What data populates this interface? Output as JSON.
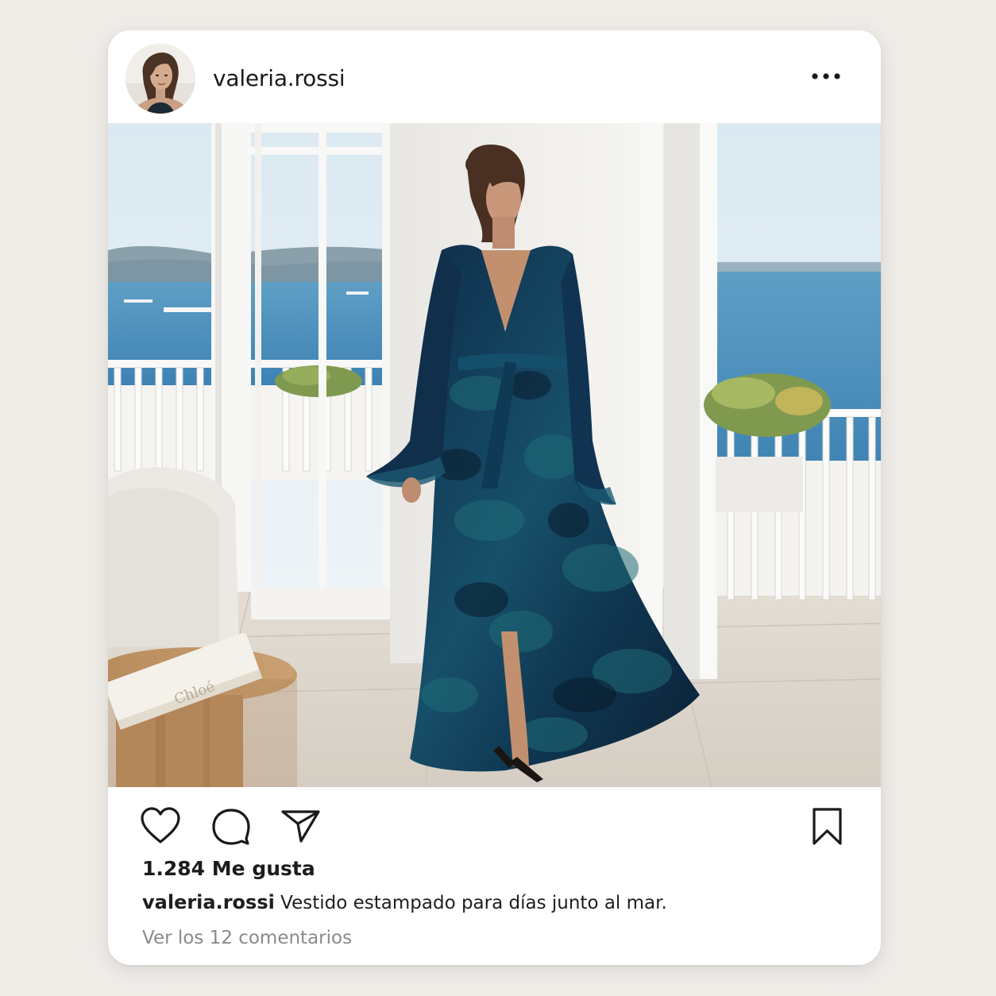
{
  "post": {
    "username": "valeria.rossi",
    "more_icon": "more-horizontal-icon",
    "photo_subject": "woman-in-floral-maxi-dress",
    "book_cover_text": "Chloé",
    "likes_text": "1.284 Me gusta",
    "caption_user": "valeria.rossi",
    "caption_text": "Vestido estampado para días junto al mar.",
    "comments_link": "Ver los 12 comentarios"
  },
  "actions": {
    "like_icon": "heart-icon",
    "comment_icon": "comment-icon",
    "share_icon": "send-icon",
    "save_icon": "bookmark-icon"
  },
  "colors": {
    "background": "#efece8",
    "card": "#ffffff",
    "text": "#1a1a1a",
    "muted_text": "#8a8a8a",
    "dress_primary": "#123a5c",
    "dress_accent": "#1f6b78",
    "sea": "#4f92bd"
  }
}
